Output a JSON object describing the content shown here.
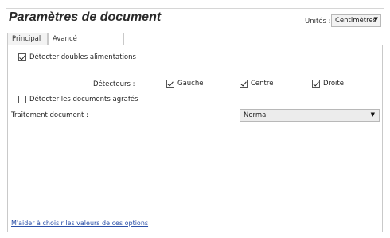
{
  "header": {
    "title": "Paramètres de document",
    "units_label": "Unités :",
    "units_value": "Centimètres"
  },
  "tabs": [
    {
      "label": "Principal",
      "active": false
    },
    {
      "label": "Avancé",
      "active": true
    }
  ],
  "options": {
    "double_feed": {
      "label": "Détecter doubles alimentations",
      "checked": true
    },
    "detectors_label": "Détecteurs :",
    "detectors": [
      {
        "label": "Gauche",
        "checked": true
      },
      {
        "label": "Centre",
        "checked": true
      },
      {
        "label": "Droite",
        "checked": true
      }
    ],
    "stapled": {
      "label": "Détecter les documents agrafés",
      "checked": false
    },
    "processing_label": "Traitement document :",
    "processing_value": "Normal"
  },
  "help_link": "M'aider à choisir les valeurs de ces options",
  "icons": {
    "dropdown": "chevron-down-icon",
    "checkbox": "checkmark-icon"
  },
  "colors": {
    "link": "#2a4fa8",
    "border": "#c9c9c9"
  }
}
